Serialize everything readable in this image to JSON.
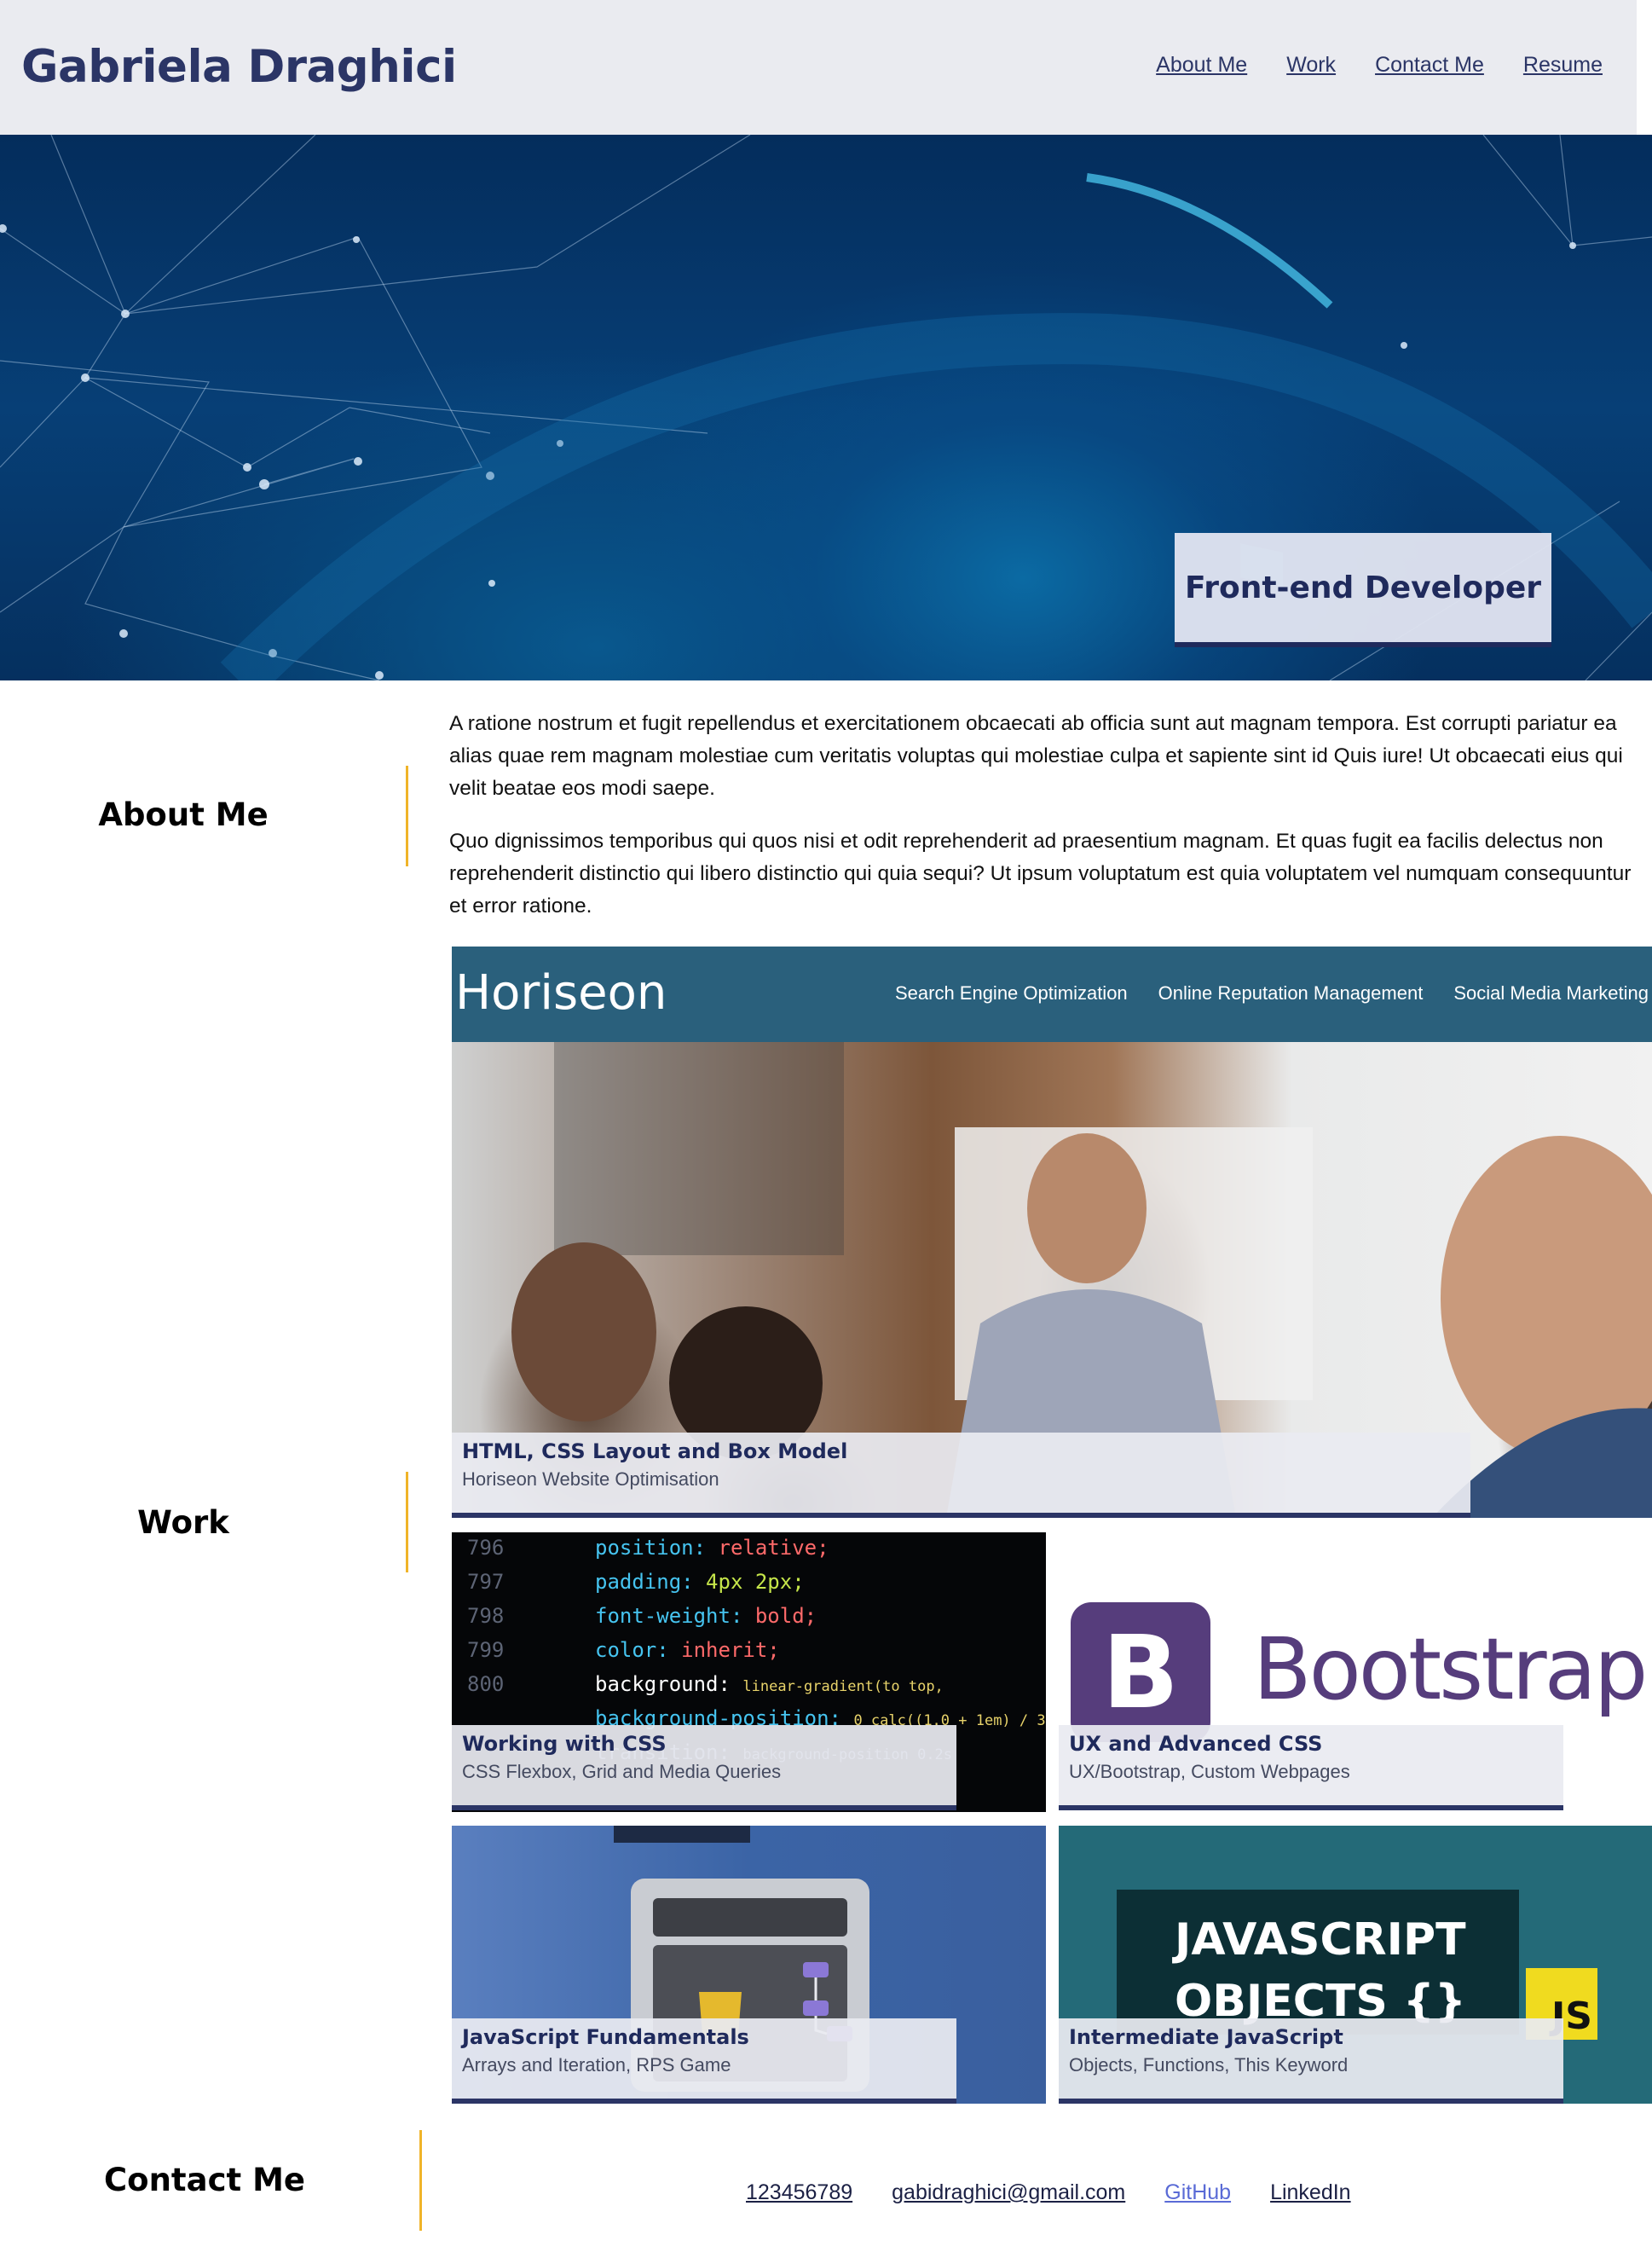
{
  "header": {
    "brand": "Gabriela Draghici",
    "nav": [
      "About Me",
      "Work",
      "Contact Me",
      "Resume"
    ]
  },
  "hero": {
    "tagline": "Front-end Developer"
  },
  "about": {
    "label": "About Me",
    "paragraphs": [
      "A ratione nostrum et fugit repellendus et exercitationem obcaecati ab officia sunt aut magnam tempora. Est corrupti pariatur ea alias quae rem magnam molestiae cum veritatis voluptas qui molestiae culpa et sapiente sint id Quis iure! Ut obcaecati eius qui velit beatae eos modi saepe.",
      "Quo dignissimos temporibus qui quos nisi et odit reprehenderit ad praesentium magnam. Et quas fugit ea facilis delectus non reprehenderit distinctio qui libero distinctio qui quia sequi? Ut ipsum voluptatum est quia voluptatem vel numquam consequuntur et error ratione."
    ]
  },
  "work": {
    "label": "Work",
    "featured": {
      "screenshot_logo": "Horiseon",
      "screenshot_nav": [
        "Search Engine Optimization",
        "Online Reputation Management",
        "Social Media Marketing"
      ],
      "title": "HTML, CSS Layout and Box Model",
      "subtitle": "Horiseon Website Optimisation"
    },
    "projects": [
      {
        "title": "Working with CSS",
        "subtitle": "CSS Flexbox, Grid and Media Queries",
        "code_lines": [
          {
            "n": "796",
            "prop": "position:",
            "val": "relative;"
          },
          {
            "n": "797",
            "prop": "padding:",
            "val": "4px 2px;"
          },
          {
            "n": "798",
            "prop": "font-weight:",
            "val": "bold;"
          },
          {
            "n": "799",
            "prop": "color:",
            "val": "inherit;"
          },
          {
            "n": "800",
            "prop": "background:",
            "val": "linear-gradient(to top,"
          },
          {
            "n": "",
            "prop": "background-position:",
            "val": "0 calc((1.0 + 1em) / 3)"
          },
          {
            "n": "",
            "prop": "transition:",
            "val": "background-position 0.2s"
          }
        ]
      },
      {
        "title": "UX and Advanced CSS",
        "subtitle": "UX/Bootstrap, Custom Webpages",
        "logo_letter": "B",
        "logo_word": "Bootstrap"
      },
      {
        "title": "JavaScript Fundamentals",
        "subtitle": "Arrays and Iteration, RPS Game"
      },
      {
        "title": "Intermediate JavaScript",
        "subtitle": "Objects, Functions, This Keyword",
        "board_line1": "JAVASCRIPT",
        "board_line2": "OBJECTS {}",
        "badge": "JS"
      }
    ]
  },
  "contact": {
    "label": "Contact Me",
    "links": [
      "123456789",
      "gabidraghici@gmail.com",
      "GitHub",
      "LinkedIn"
    ]
  },
  "colors": {
    "brand": "#2b3566",
    "accent_rule": "#f0b429",
    "header_bg": "#eaebf0",
    "horiseon_bar": "#2a607c"
  }
}
